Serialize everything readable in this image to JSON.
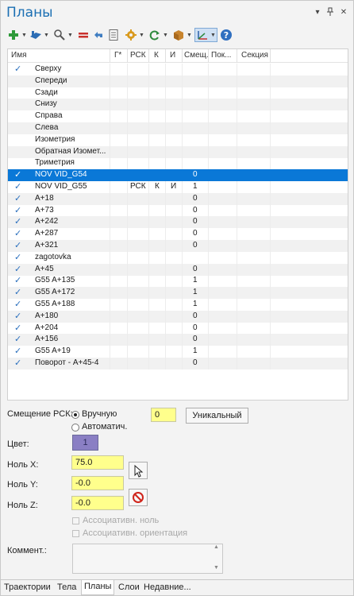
{
  "panel": {
    "title": "Планы",
    "pin_icon": "pin-icon",
    "close_label": "✕",
    "menu_label": "▾"
  },
  "toolbar": {
    "tools": [
      "add-icon",
      "plane-icon",
      "zoom-icon",
      "equal-icon",
      "undo-icon",
      "list-icon",
      "gear-icon",
      "refresh-icon",
      "cube-icon",
      "axes-icon",
      "help-icon"
    ]
  },
  "grid": {
    "columns": [
      "Имя",
      "Г*",
      "РСК",
      "К",
      "И",
      "Смещ.",
      "Пок...",
      "Секция"
    ],
    "rows": [
      {
        "checked": "✓",
        "name": "Сверху",
        "rsk": "",
        "k": "",
        "i": "",
        "offset": ""
      },
      {
        "checked": "",
        "name": "Спереди",
        "rsk": "",
        "k": "",
        "i": "",
        "offset": ""
      },
      {
        "checked": "",
        "name": "Сзади",
        "rsk": "",
        "k": "",
        "i": "",
        "offset": ""
      },
      {
        "checked": "",
        "name": "Снизу",
        "rsk": "",
        "k": "",
        "i": "",
        "offset": ""
      },
      {
        "checked": "",
        "name": "Справа",
        "rsk": "",
        "k": "",
        "i": "",
        "offset": ""
      },
      {
        "checked": "",
        "name": "Слева",
        "rsk": "",
        "k": "",
        "i": "",
        "offset": ""
      },
      {
        "checked": "",
        "name": "Изометрия",
        "rsk": "",
        "k": "",
        "i": "",
        "offset": ""
      },
      {
        "checked": "",
        "name": "Обратная Изомет...",
        "rsk": "",
        "k": "",
        "i": "",
        "offset": ""
      },
      {
        "checked": "",
        "name": "Триметрия",
        "rsk": "",
        "k": "",
        "i": "",
        "offset": ""
      },
      {
        "checked": "✓",
        "name": "NOV VID_G54",
        "rsk": "",
        "k": "",
        "i": "",
        "offset": "0"
      },
      {
        "checked": "✓",
        "name": "NOV VID_G55",
        "rsk": "РСК",
        "k": "К",
        "i": "И",
        "offset": "1"
      },
      {
        "checked": "✓",
        "name": "A+18",
        "rsk": "",
        "k": "",
        "i": "",
        "offset": "0"
      },
      {
        "checked": "✓",
        "name": "A+73",
        "rsk": "",
        "k": "",
        "i": "",
        "offset": "0"
      },
      {
        "checked": "✓",
        "name": "A+242",
        "rsk": "",
        "k": "",
        "i": "",
        "offset": "0"
      },
      {
        "checked": "✓",
        "name": "A+287",
        "rsk": "",
        "k": "",
        "i": "",
        "offset": "0"
      },
      {
        "checked": "✓",
        "name": "A+321",
        "rsk": "",
        "k": "",
        "i": "",
        "offset": "0"
      },
      {
        "checked": "✓",
        "name": "zagotovka",
        "rsk": "",
        "k": "",
        "i": "",
        "offset": ""
      },
      {
        "checked": "✓",
        "name": "A+45",
        "rsk": "",
        "k": "",
        "i": "",
        "offset": "0"
      },
      {
        "checked": "✓",
        "name": "G55 A+135",
        "rsk": "",
        "k": "",
        "i": "",
        "offset": "1"
      },
      {
        "checked": "✓",
        "name": "G55 A+172",
        "rsk": "",
        "k": "",
        "i": "",
        "offset": "1"
      },
      {
        "checked": "✓",
        "name": "G55 A+188",
        "rsk": "",
        "k": "",
        "i": "",
        "offset": "1"
      },
      {
        "checked": "✓",
        "name": "A+180",
        "rsk": "",
        "k": "",
        "i": "",
        "offset": "0"
      },
      {
        "checked": "✓",
        "name": "A+204",
        "rsk": "",
        "k": "",
        "i": "",
        "offset": "0"
      },
      {
        "checked": "✓",
        "name": "A+156",
        "rsk": "",
        "k": "",
        "i": "",
        "offset": "0"
      },
      {
        "checked": "✓",
        "name": "G55 A+19",
        "rsk": "",
        "k": "",
        "i": "",
        "offset": "1"
      },
      {
        "checked": "✓",
        "name": "Поворот - A+45-4",
        "rsk": "",
        "k": "",
        "i": "",
        "offset": "0"
      }
    ],
    "selected_row": "NOV VID_G54"
  },
  "props": {
    "rsk_offset_label": "Смещение РСК:",
    "manual_label": "Вручную",
    "auto_label": "Автоматич.",
    "offset_value": "0",
    "unique_button": "Уникальный",
    "color_label": "Цвет:",
    "color_value": "1",
    "color_swatch": "#8a7fc4",
    "zero_x_label": "Ноль X:",
    "zero_x_value": "75.0",
    "zero_y_label": "Ноль Y:",
    "zero_y_value": "-0.0",
    "zero_z_label": "Ноль Z:",
    "zero_z_value": "-0.0",
    "assoc_zero_label": "Ассоциативн. ноль",
    "assoc_orient_label": "Ассоциативн. ориентация",
    "comment_label": "Коммент.:",
    "comment_value": ""
  },
  "tabs": [
    "Траектории",
    "Тела",
    "Планы",
    "Слои",
    "Недавние..."
  ],
  "active_tab": "Планы",
  "colors": {
    "title": "#1b6fb3",
    "selection": "#0a78d7",
    "input_yellow": "#ffff8c"
  }
}
